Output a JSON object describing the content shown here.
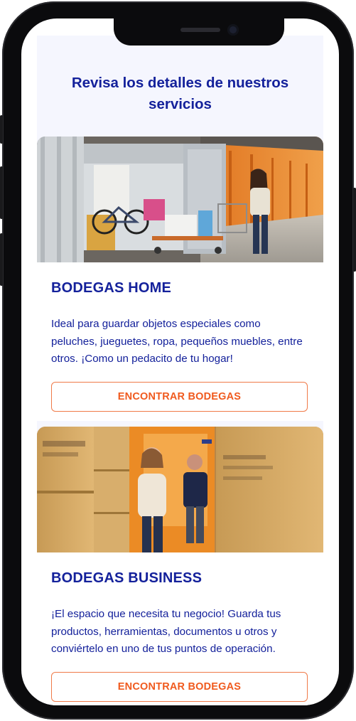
{
  "page": {
    "heading": "Revisa los detalles de nuestros servicios"
  },
  "services": [
    {
      "title": "BODEGAS HOME",
      "description": "Ideal para guardar objetos especiales como peluches, jueguetes, ropa, pequeños muebles, entre otros. ¡Como un pedacito de tu hogar!",
      "cta_label": "ENCONTRAR BODEGAS"
    },
    {
      "title": "BODEGAS BUSINESS",
      "description": "¡El espacio que necesita tu negocio! Guarda tus productos, herramientas, documentos u otros y conviértelo en uno de tus puntos de operación.",
      "cta_label": "ENCONTRAR BODEGAS"
    }
  ],
  "colors": {
    "brand_blue": "#14219b",
    "accent_orange": "#f05a1e",
    "page_background": "#f5f6fe"
  }
}
